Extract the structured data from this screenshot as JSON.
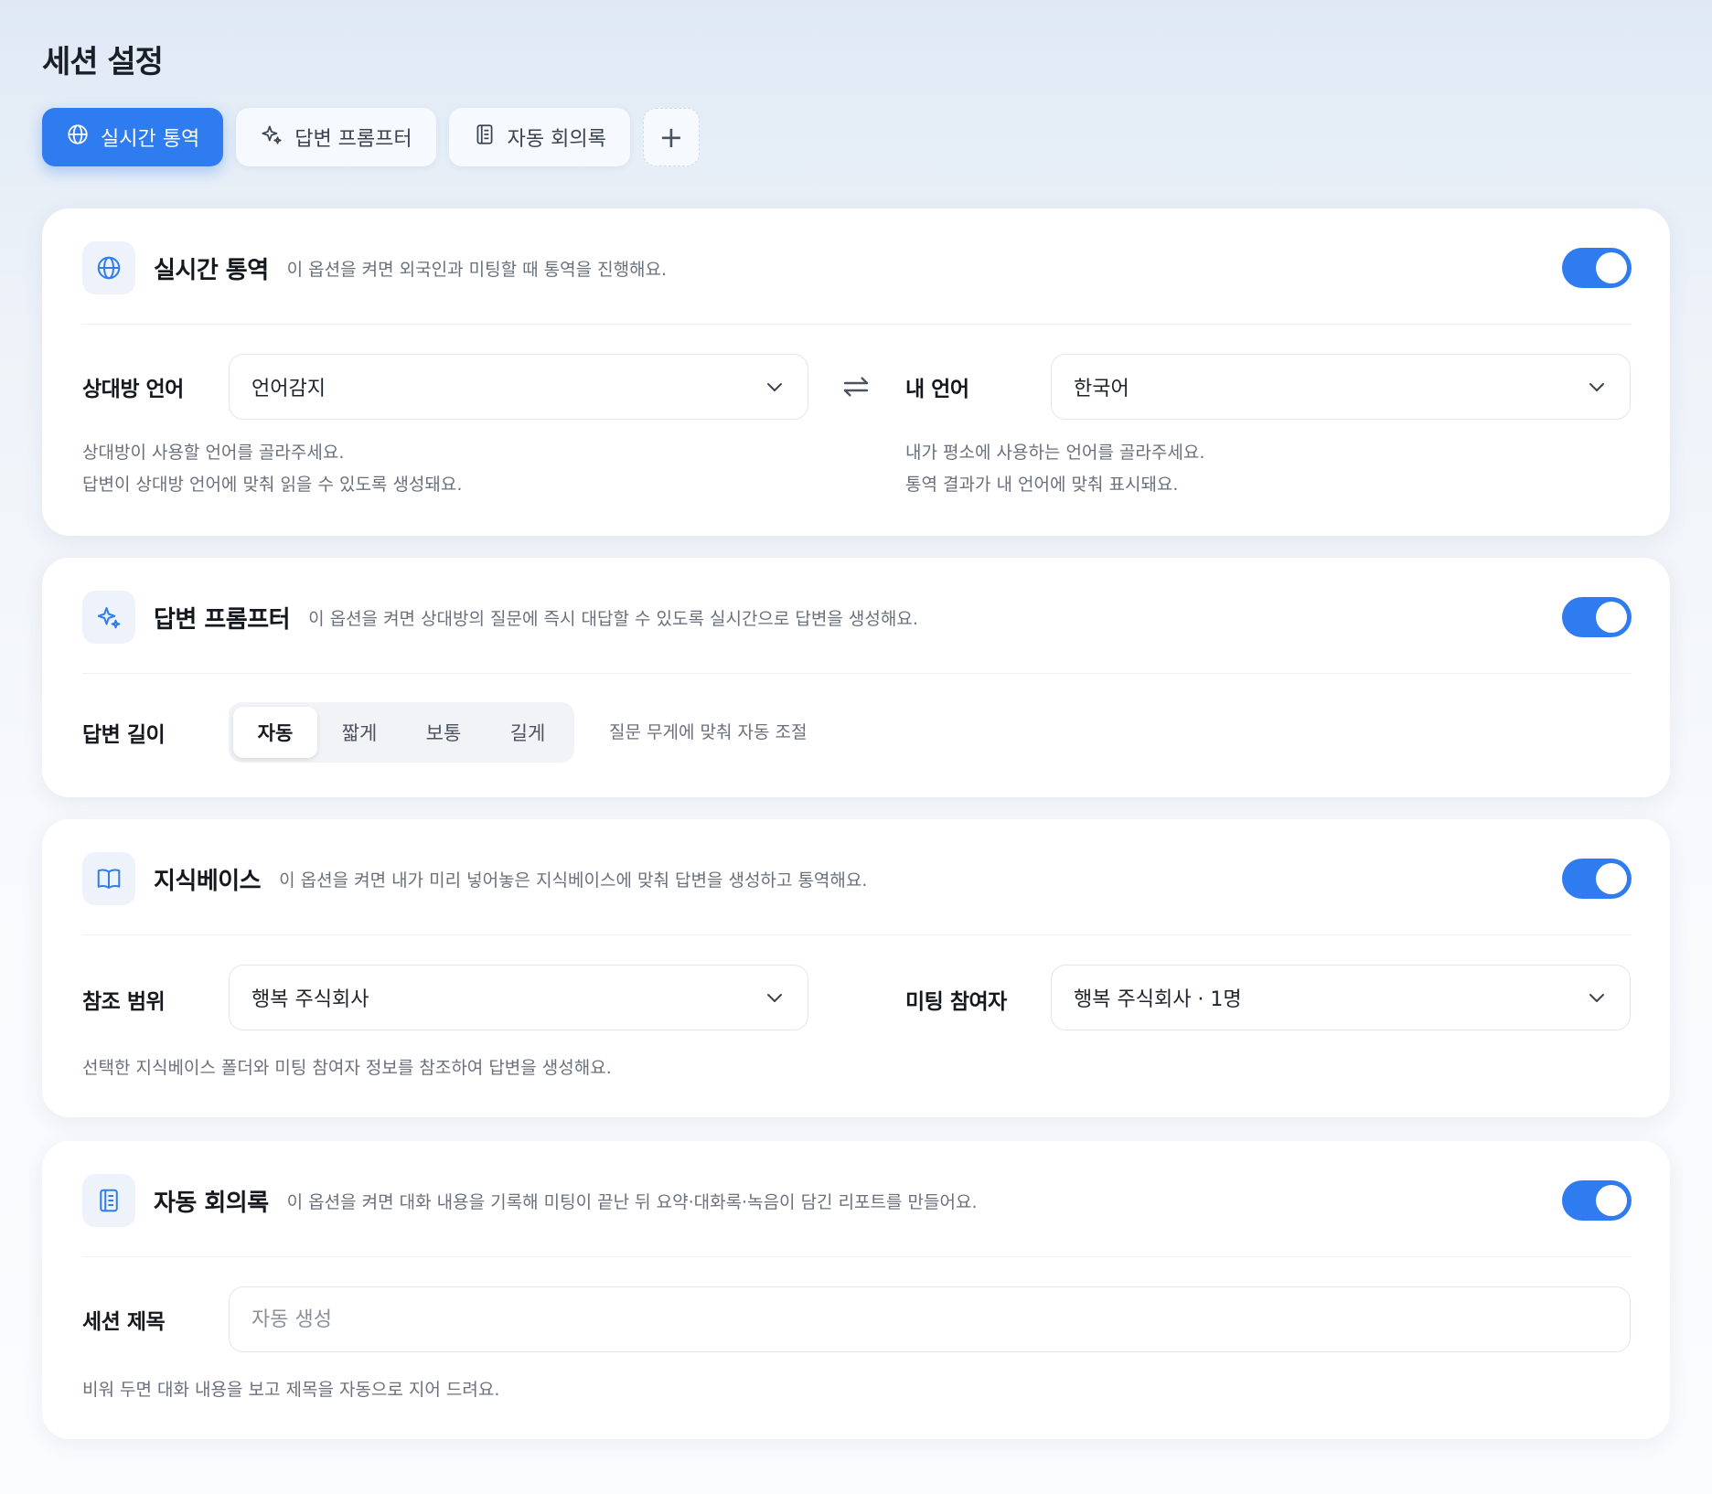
{
  "page": {
    "title": "세션 설정"
  },
  "tabs": [
    {
      "label": "실시간 통역",
      "icon": "globe-icon",
      "active": true
    },
    {
      "label": "답변 프롬프터",
      "icon": "sparkle-icon",
      "active": false
    },
    {
      "label": "자동 회의록",
      "icon": "document-icon",
      "active": false
    }
  ],
  "add_tab": {
    "label": "+"
  },
  "colors": {
    "accent": "#2f7cf0"
  },
  "interpretation": {
    "title": "실시간 통역",
    "description": "이 옵션을 켜면 외국인과 미팅할 때 통역을 진행해요.",
    "enabled": true,
    "partner_language": {
      "label": "상대방 언어",
      "value": "언어감지",
      "helper_1": "상대방이 사용할 언어를 골라주세요.",
      "helper_2": "답변이 상대방 언어에 맞춰 읽을 수 있도록 생성돼요."
    },
    "my_language": {
      "label": "내 언어",
      "value": "한국어",
      "helper_1": "내가 평소에 사용하는 언어를 골라주세요.",
      "helper_2": "통역 결과가 내 언어에 맞춰 표시돼요."
    }
  },
  "prompter": {
    "title": "답변 프롬프터",
    "description": "이 옵션을 켜면 상대방의 질문에 즉시 대답할 수 있도록 실시간으로 답변을 생성해요.",
    "enabled": true,
    "length": {
      "label": "답변 길이",
      "options": [
        "자동",
        "짧게",
        "보통",
        "길게"
      ],
      "selected": "자동",
      "hint": "질문 무게에 맞춰 자동 조절"
    }
  },
  "knowledge": {
    "title": "지식베이스",
    "description": "이 옵션을 켜면 내가 미리 넣어놓은 지식베이스에 맞춰 답변을 생성하고 통역해요.",
    "enabled": true,
    "scope": {
      "label": "참조 범위",
      "value": "행복 주식회사"
    },
    "participants": {
      "label": "미팅 참여자",
      "value": "행복 주식회사 · 1명"
    },
    "helper": "선택한 지식베이스 폴더와 미팅 참여자 정보를 참조하여 답변을 생성해요."
  },
  "minutes": {
    "title": "자동 회의록",
    "description": "이 옵션을 켜면 대화 내용을 기록해 미팅이 끝난 뒤 요약·대화록·녹음이 담긴 리포트를 만들어요.",
    "enabled": true,
    "session_title": {
      "label": "세션 제목",
      "placeholder": "자동 생성",
      "value": ""
    },
    "helper": "비워 두면 대화 내용을 보고 제목을 자동으로 지어 드려요."
  }
}
